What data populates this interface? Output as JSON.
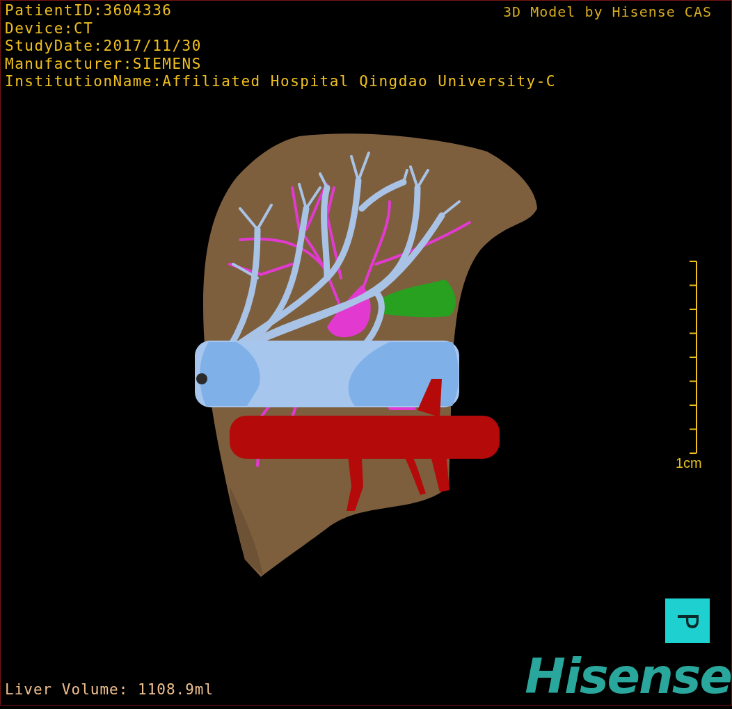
{
  "study_info": [
    {
      "text": "PatientID:3604336"
    },
    {
      "text": "Device:CT"
    },
    {
      "text": "StudyDate:2017/11/30"
    },
    {
      "text": "Manufacturer:SIEMENS"
    },
    {
      "text": "InstitutionName:Affiliated Hospital Qingdao University-C"
    }
  ],
  "model_credit": "3D Model by Hisense CAS",
  "scale_bar": {
    "label": "1cm"
  },
  "orientation_cube": {
    "label": "P"
  },
  "liver_volume": "Liver Volume: 1108.9ml",
  "brand": "Hisense"
}
